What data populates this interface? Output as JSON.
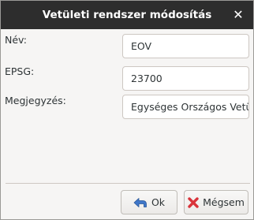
{
  "window": {
    "title": "Vetületi rendszer módosítás",
    "close_glyph": "✕"
  },
  "form": {
    "fields": [
      {
        "label": "Név:",
        "value": "EOV"
      },
      {
        "label": "EPSG:",
        "value": "23700"
      },
      {
        "label": "Megjegyzés:",
        "value": "Egységes Országos Vetületi"
      }
    ]
  },
  "buttons": {
    "ok_label": "Ok",
    "ok_icon": "arrow-left-icon",
    "cancel_label": "Mégsem",
    "cancel_icon": "red-x-icon"
  },
  "colors": {
    "titlebar": "#2d2d2d",
    "ok_icon": "#3f77c9",
    "cancel_icon": "#d9333a"
  }
}
